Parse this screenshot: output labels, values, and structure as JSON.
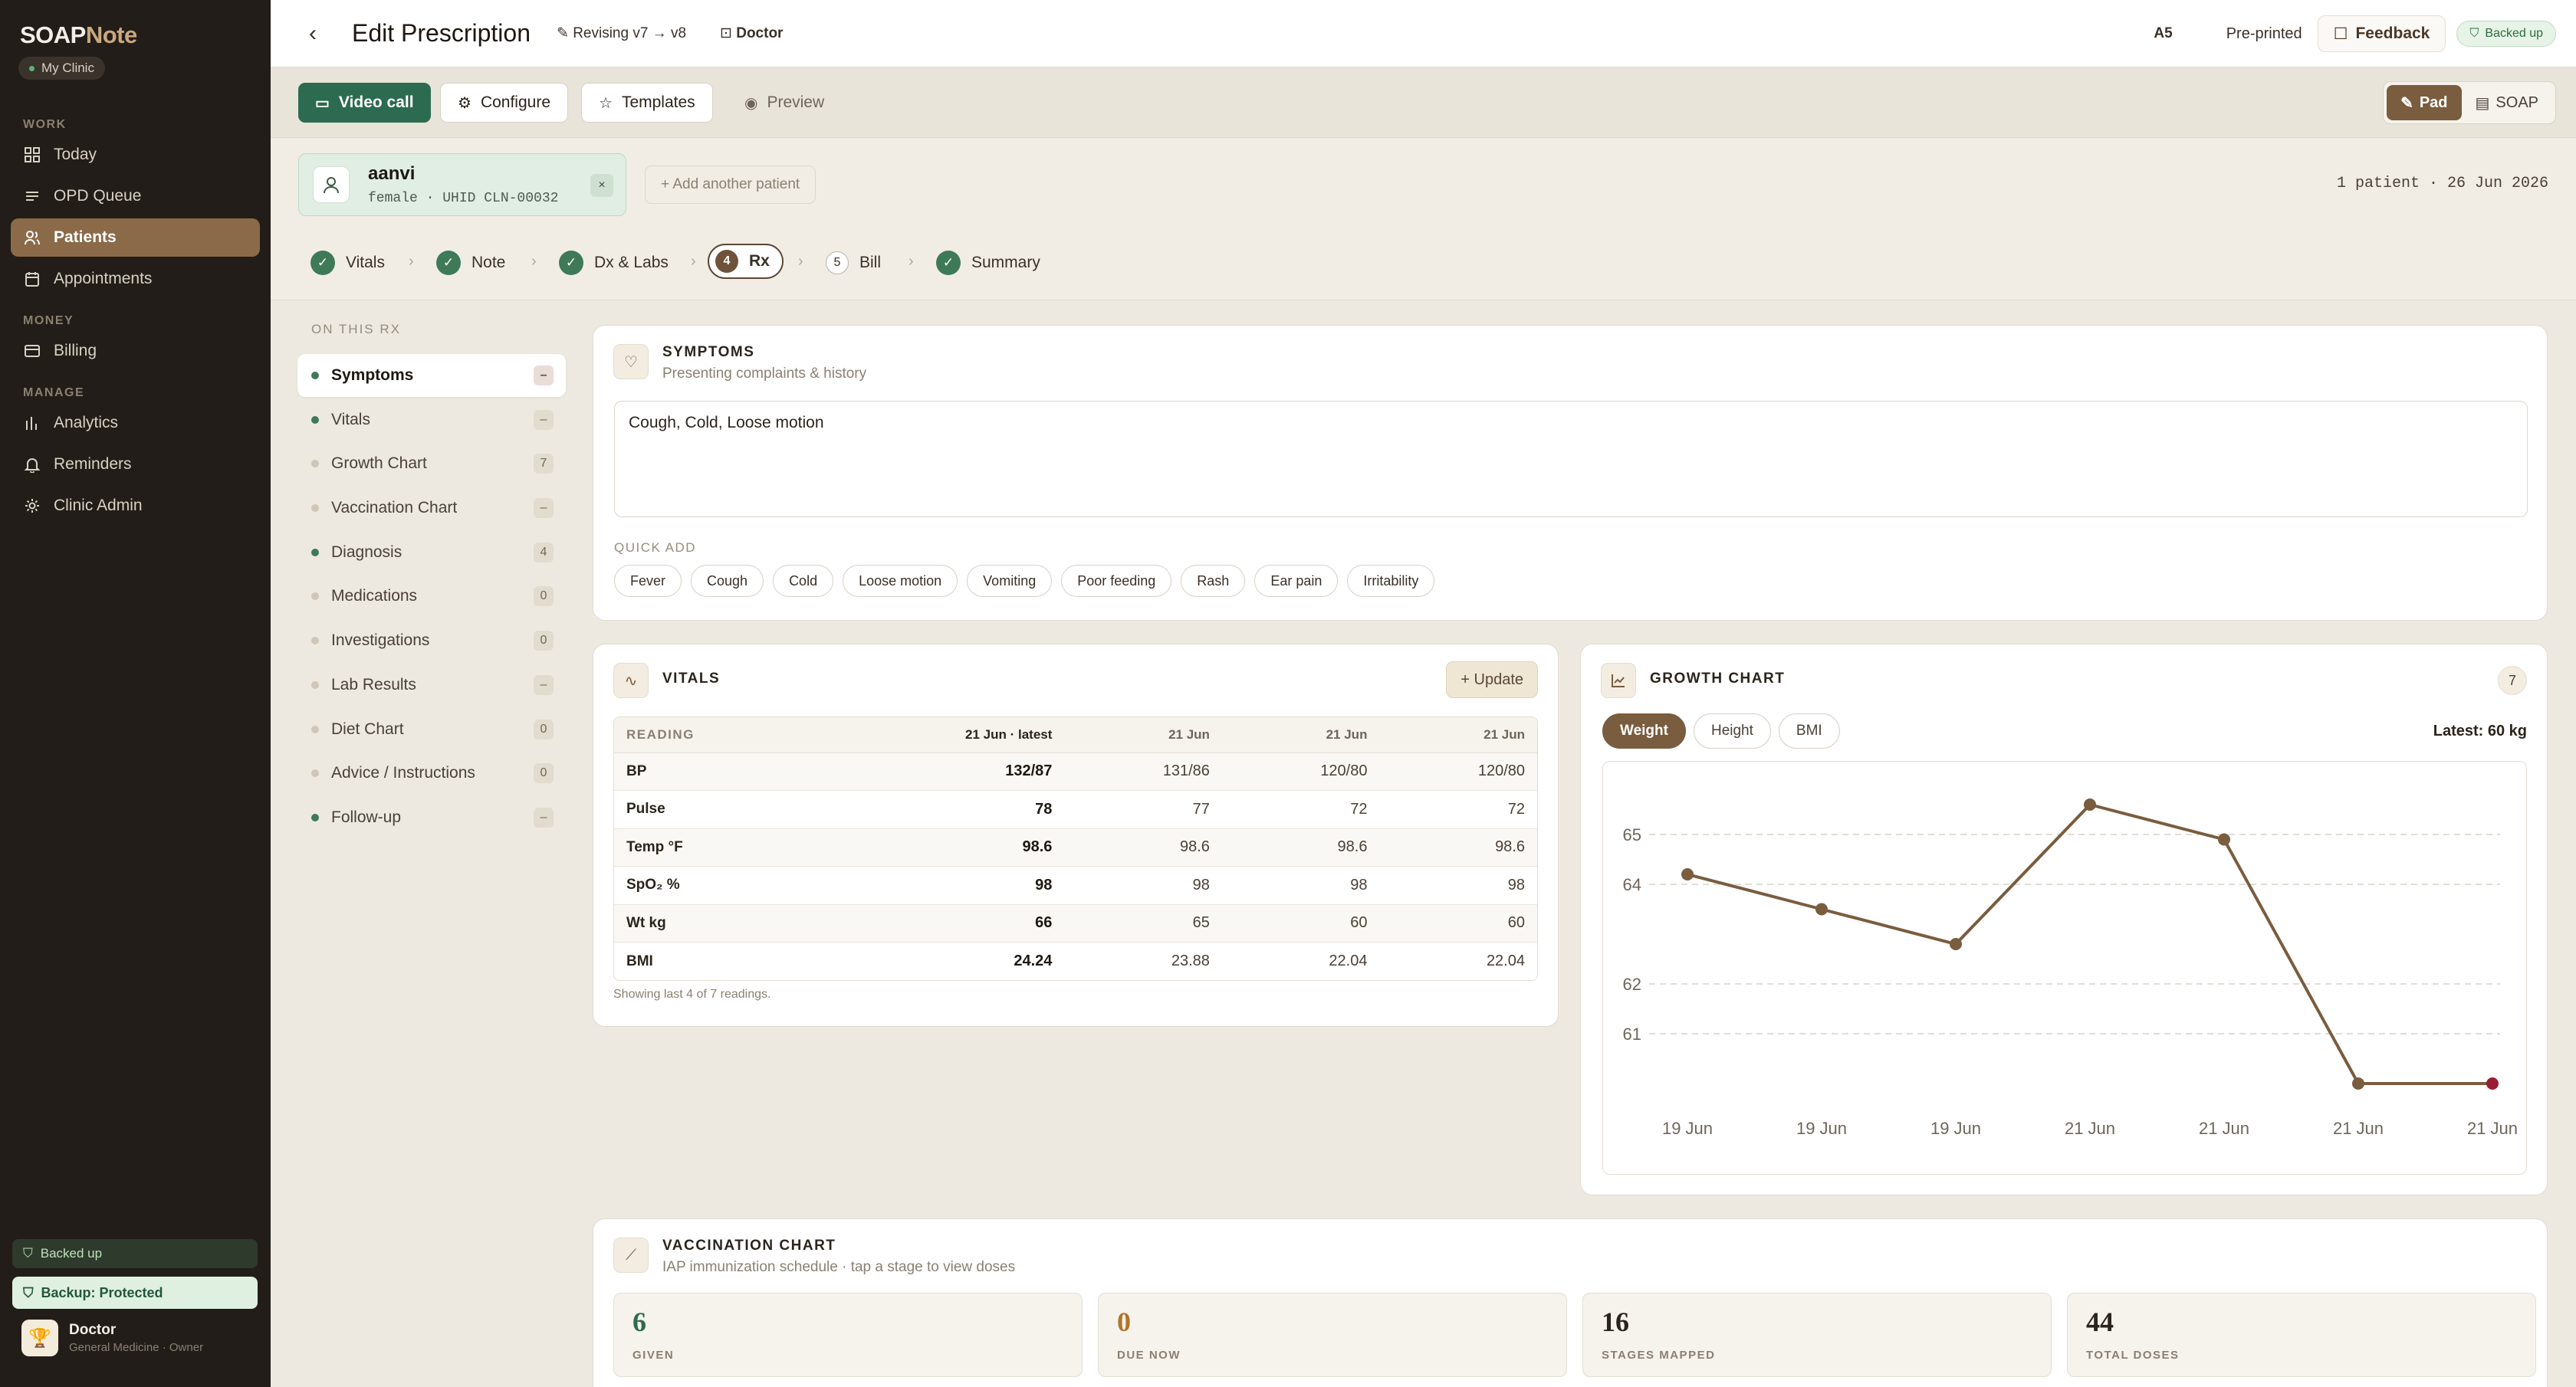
{
  "brand": {
    "soap": "SOAP",
    "note": "Note",
    "clinic": "My Clinic"
  },
  "sidebar": {
    "groups": [
      "WORK",
      "MONEY",
      "MANAGE"
    ],
    "items": [
      {
        "label": "Today",
        "icon": "grid-icon"
      },
      {
        "label": "OPD Queue",
        "icon": "list-icon"
      },
      {
        "label": "Patients",
        "icon": "users-icon",
        "active": true
      },
      {
        "label": "Appointments",
        "icon": "calendar-icon"
      },
      {
        "label": "Billing",
        "icon": "receipt-icon"
      },
      {
        "label": "Analytics",
        "icon": "bar-chart-icon"
      },
      {
        "label": "Reminders",
        "icon": "bell-icon"
      },
      {
        "label": "Clinic Admin",
        "icon": "gear-icon"
      }
    ],
    "backed_up": "Backed up",
    "backup_status": "Backup: Protected",
    "user": {
      "name": "Doctor",
      "role": "General Medicine · Owner"
    }
  },
  "header": {
    "title": "Edit Prescription",
    "revision": "Revising v7 → v8",
    "role": "Doctor",
    "paper_size": "A5",
    "paper_type": "Pre-printed",
    "feedback": "Feedback",
    "backed_up": "Backed up"
  },
  "toolbar": {
    "video_call": "Video call",
    "configure": "Configure",
    "templates": "Templates",
    "preview": "Preview",
    "pad": "Pad",
    "soap": "SOAP"
  },
  "patient": {
    "name": "aanvi",
    "meta": "female · UHID CLN-00032",
    "remove": "×",
    "add_another": "+ Add another patient",
    "summary": "1 patient · 26 Jun 2026"
  },
  "steps": [
    {
      "label": "Vitals",
      "done": true
    },
    {
      "label": "Note",
      "done": true
    },
    {
      "label": "Dx & Labs",
      "done": true
    },
    {
      "num": "4",
      "label": "Rx",
      "current": true
    },
    {
      "num": "5",
      "label": "Bill"
    },
    {
      "label": "Summary",
      "done": true
    }
  ],
  "toc": {
    "heading": "ON THIS RX",
    "items": [
      {
        "label": "Symptoms",
        "count": "–",
        "filled": true,
        "active": true
      },
      {
        "label": "Vitals",
        "count": "–",
        "filled": true
      },
      {
        "label": "Growth Chart",
        "count": "7",
        "filled": false
      },
      {
        "label": "Vaccination Chart",
        "count": "–",
        "filled": false
      },
      {
        "label": "Diagnosis",
        "count": "4",
        "filled": true
      },
      {
        "label": "Medications",
        "count": "0",
        "filled": false
      },
      {
        "label": "Investigations",
        "count": "0",
        "filled": false
      },
      {
        "label": "Lab Results",
        "count": "–",
        "filled": false
      },
      {
        "label": "Diet Chart",
        "count": "0",
        "filled": false
      },
      {
        "label": "Advice / Instructions",
        "count": "0",
        "filled": false
      },
      {
        "label": "Follow-up",
        "count": "–",
        "filled": true
      }
    ]
  },
  "symptoms": {
    "title": "SYMPTOMS",
    "subtitle": "Presenting complaints & history",
    "text": "Cough, Cold, Loose motion",
    "quick_add_label": "QUICK ADD",
    "chips": [
      "Fever",
      "Cough",
      "Cold",
      "Loose motion",
      "Vomiting",
      "Poor feeding",
      "Rash",
      "Ear pain",
      "Irritability"
    ]
  },
  "vitals": {
    "title": "VITALS",
    "update": "+ Update",
    "columns": [
      "READING",
      "21 Jun · latest",
      "21 Jun",
      "21 Jun",
      "21 Jun"
    ],
    "rows": [
      [
        "BP",
        "132/87",
        "131/86",
        "120/80",
        "120/80"
      ],
      [
        "Pulse",
        "78",
        "77",
        "72",
        "72"
      ],
      [
        "Temp °F",
        "98.6",
        "98.6",
        "98.6",
        "98.6"
      ],
      [
        "SpO₂ %",
        "98",
        "98",
        "98",
        "98"
      ],
      [
        "Wt kg",
        "66",
        "65",
        "60",
        "60"
      ],
      [
        "BMI",
        "24.24",
        "23.88",
        "22.04",
        "22.04"
      ]
    ],
    "note": "Showing last 4 of 7 readings."
  },
  "growth": {
    "title": "GROWTH CHART",
    "count": "7",
    "tabs": [
      "Weight",
      "Height",
      "BMI"
    ],
    "latest": "Latest: 60 kg"
  },
  "chart_data": {
    "type": "line",
    "title": "",
    "xlabel": "",
    "ylabel": "",
    "x": [
      "19 Jun",
      "19 Jun",
      "19 Jun",
      "21 Jun",
      "21 Jun",
      "21 Jun",
      "21 Jun"
    ],
    "series": [
      {
        "values": [
          64.2,
          63.5,
          62.8,
          65.6,
          64.9,
          60.0,
          60.0
        ]
      }
    ],
    "yticks": [
      61,
      62,
      64,
      65
    ],
    "ylim": [
      60,
      66
    ],
    "grid": true,
    "line_color": "#7a5c3e",
    "last_point_color": "#9b1c35"
  },
  "vaccination": {
    "title": "VACCINATION CHART",
    "subtitle": "IAP immunization schedule · tap a stage to view doses",
    "stats": [
      {
        "value": "6",
        "label": "GIVEN",
        "color": "#2c6b4f"
      },
      {
        "value": "0",
        "label": "DUE NOW",
        "color": "#b0742a"
      },
      {
        "value": "16",
        "label": "STAGES MAPPED",
        "color": "#2b241c"
      },
      {
        "value": "44",
        "label": "TOTAL DOSES",
        "color": "#2b241c"
      }
    ]
  }
}
